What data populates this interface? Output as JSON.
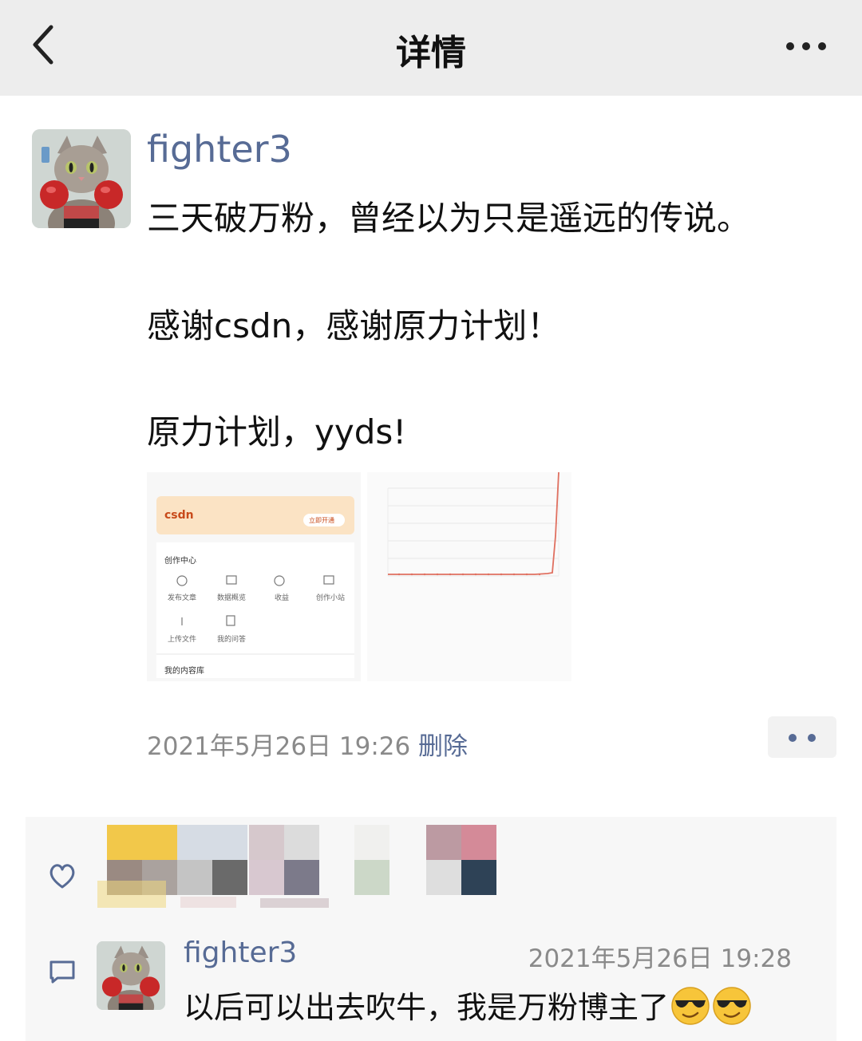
{
  "header": {
    "title": "详情",
    "back_icon": "chevron-left-icon",
    "more_icon": "more-icon"
  },
  "post": {
    "author": "fighter3",
    "lines": [
      "三天破万粉，曾经以为只是遥远的传说。",
      "感谢csdn，感谢原力计划！",
      "原力计划，yyds!"
    ],
    "timestamp": "2021年5月26日 19:26",
    "delete_label": "删除",
    "actions_icon": "two-dots-icon"
  },
  "screenshot_left": {
    "brand": "csdn",
    "promo_button": "立即开通",
    "section_title": "创作中心",
    "items": [
      "发布文章",
      "数据概览",
      "收益",
      "创作小站",
      "上传文件",
      "我的问答"
    ],
    "footer": "我的内容库"
  },
  "comment": {
    "author": "fighter3",
    "time": "2021年5月26日 19:28",
    "text": "以后可以出去吹牛，我是万粉博主了",
    "emoji": "sunglasses-emoji"
  },
  "colors": {
    "link": "#576b95",
    "header_bg": "#ededed",
    "panel_bg": "#f7f7f7",
    "chart_line": "#e07060"
  }
}
